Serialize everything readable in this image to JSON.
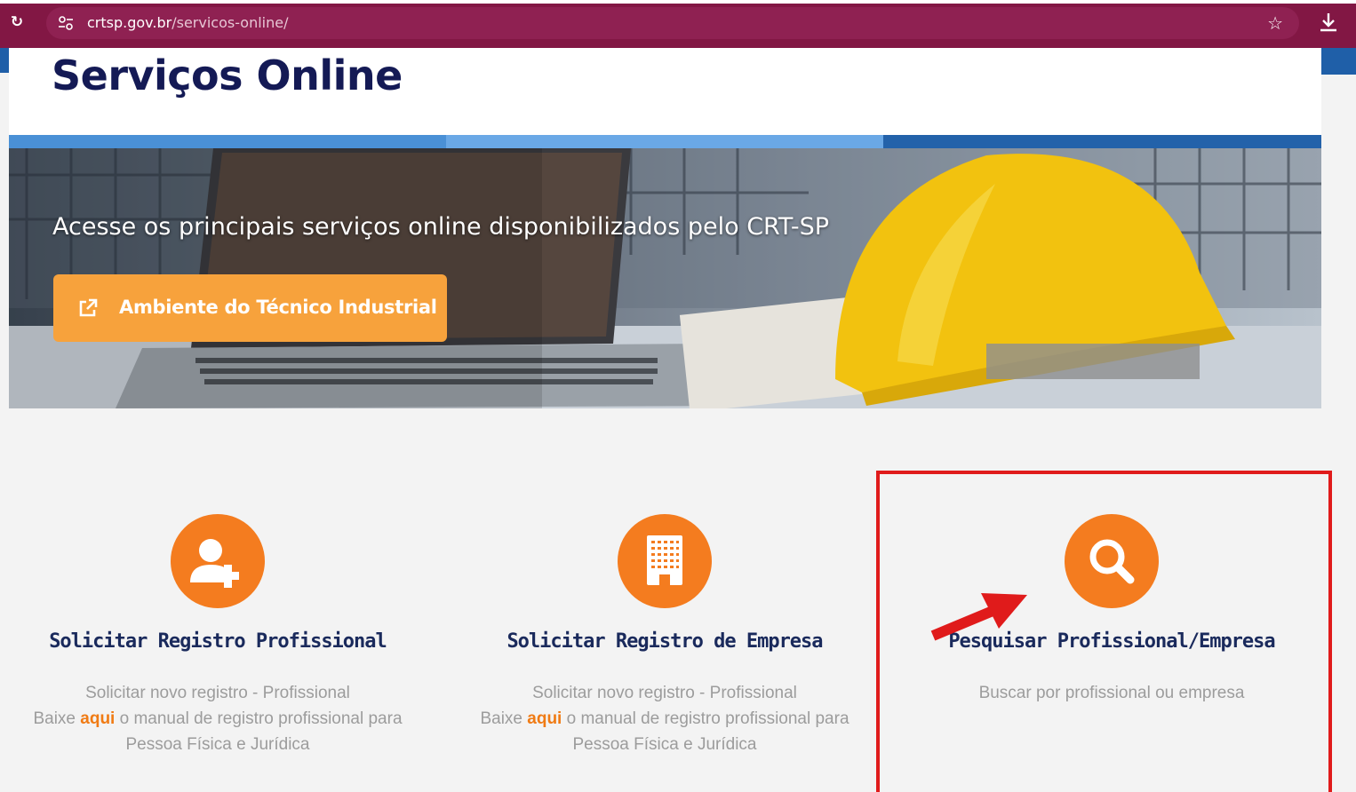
{
  "browser": {
    "url_host": "crtsp.gov.br",
    "url_path": "/servicos-online/",
    "reload_icon": "reload-icon",
    "star_icon": "star-icon",
    "download_icon": "download-icon"
  },
  "header": {
    "title": "Serviços Online"
  },
  "hero": {
    "text": "Acesse os principais serviços online disponibilizados pelo CRT-SP",
    "button_label": "Ambiente do Técnico Industrial"
  },
  "cards": [
    {
      "icon": "user-plus-icon",
      "title": "Solicitar Registro Profissional",
      "desc_line1": "Solicitar novo registro - Profissional",
      "desc_pre": "Baixe ",
      "desc_link": "aqui",
      "desc_post": " o manual de registro profissional para",
      "desc_line3": "Pessoa Física e Jurídica"
    },
    {
      "icon": "building-icon",
      "title": "Solicitar Registro de Empresa",
      "desc_line1": "Solicitar novo registro - Profissional",
      "desc_pre": "Baixe ",
      "desc_link": "aqui",
      "desc_post": " o manual de registro profissional para",
      "desc_line3": "Pessoa Física e Jurídica"
    },
    {
      "icon": "search-icon",
      "title": "Pesquisar Profissional/Empresa",
      "desc_line1": "Buscar por profissional ou empresa"
    }
  ],
  "colors": {
    "browser_bar": "#821744",
    "accent_orange": "#f47c1f",
    "button_orange": "#f7a23c",
    "title_navy": "#141a55",
    "highlight_red": "#e01b1b"
  }
}
